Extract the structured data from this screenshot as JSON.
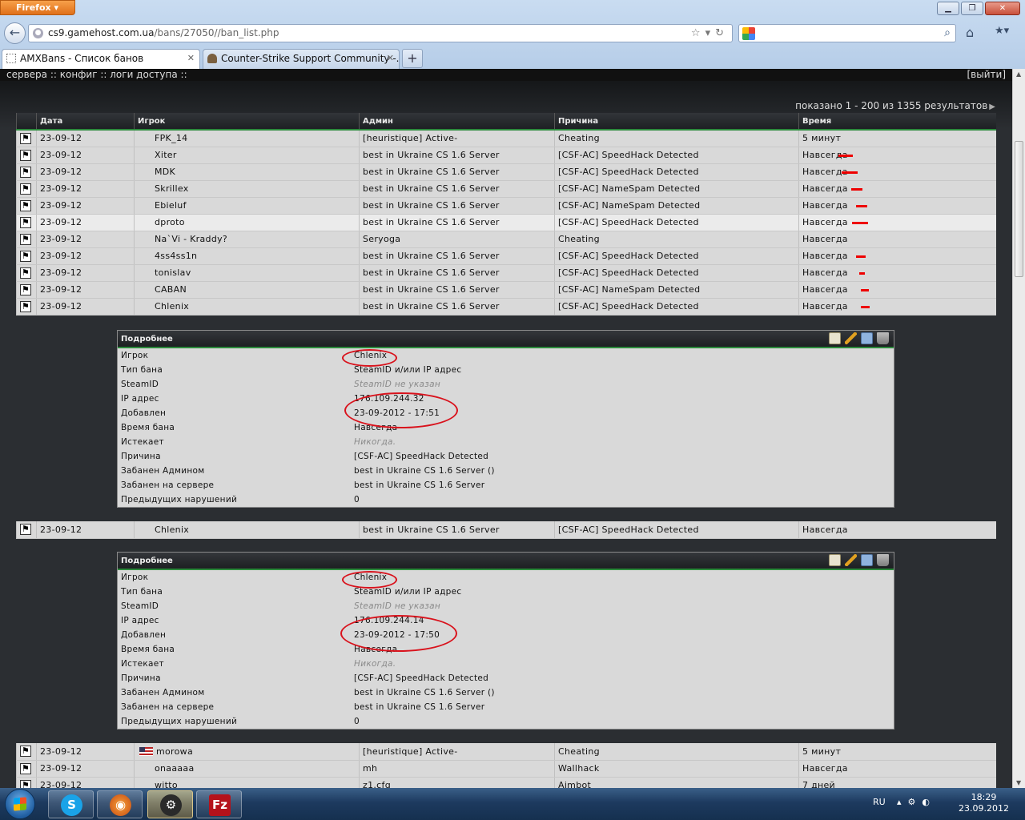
{
  "browser": {
    "menu_button": "Firefox",
    "url_domain": "cs9.gamehost.com.ua",
    "url_path": "/bans/27050//ban_list.php",
    "tabs": [
      {
        "title": "AMXBans - Список банов",
        "active": true
      },
      {
        "title": "Counter-Strike Support Community -...",
        "active": false
      }
    ],
    "new_tab": "+"
  },
  "page": {
    "nav": "сервера :: конфиг :: логи доступа ::",
    "logout": "[выйти]",
    "results": "показано 1 - 200 из 1355 результатов",
    "columns": {
      "date": "Дата",
      "player": "Игрок",
      "admin": "Админ",
      "reason": "Причина",
      "time": "Время"
    },
    "rows": [
      {
        "date": "23-09-12",
        "player": "FPK_14",
        "admin": "[heuristique] Active-",
        "reason": "Cheating",
        "time": "5 минут"
      },
      {
        "date": "23-09-12",
        "player": "Xiter",
        "admin": "best in Ukraine CS 1.6 Server",
        "reason": "[CSF-AC] SpeedHack Detected",
        "time": "Навсегда"
      },
      {
        "date": "23-09-12",
        "player": "MDK",
        "admin": "best in Ukraine CS 1.6 Server",
        "reason": "[CSF-AC] SpeedHack Detected",
        "time": "Навсегда"
      },
      {
        "date": "23-09-12",
        "player": "Skrillex",
        "admin": "best in Ukraine CS 1.6 Server",
        "reason": "[CSF-AC] NameSpam Detected",
        "time": "Навсегда"
      },
      {
        "date": "23-09-12",
        "player": "Ebieluf",
        "admin": "best in Ukraine CS 1.6 Server",
        "reason": "[CSF-AC] NameSpam Detected",
        "time": "Навсегда"
      },
      {
        "date": "23-09-12",
        "player": "dproto",
        "admin": "best in Ukraine CS 1.6 Server",
        "reason": "[CSF-AC] SpeedHack Detected",
        "time": "Навсегда"
      },
      {
        "date": "23-09-12",
        "player": "Na`Vi - Kraddy?",
        "admin": "Seryoga",
        "reason": "Cheating",
        "time": "Навсегда"
      },
      {
        "date": "23-09-12",
        "player": "4ss4ss1n",
        "admin": "best in Ukraine CS 1.6 Server",
        "reason": "[CSF-AC] SpeedHack Detected",
        "time": "Навсегда"
      },
      {
        "date": "23-09-12",
        "player": "tonislav",
        "admin": "best in Ukraine CS 1.6 Server",
        "reason": "[CSF-AC] SpeedHack Detected",
        "time": "Навсегда"
      },
      {
        "date": "23-09-12",
        "player": "CABAN",
        "admin": "best in Ukraine CS 1.6 Server",
        "reason": "[CSF-AC] NameSpam Detected",
        "time": "Навсегда"
      },
      {
        "date": "23-09-12",
        "player": "Chlenix",
        "admin": "best in Ukraine CS 1.6 Server",
        "reason": "[CSF-AC] SpeedHack Detected",
        "time": "Навсегда"
      },
      {
        "date": "23-09-12",
        "player": "Chlenix",
        "admin": "best in Ukraine CS 1.6 Server",
        "reason": "[CSF-AC] SpeedHack Detected",
        "time": "Навсегда"
      },
      {
        "date": "23-09-12",
        "player": "morowa",
        "admin": "[heuristique] Active-",
        "reason": "Cheating",
        "time": "5 минут"
      },
      {
        "date": "23-09-12",
        "player": "onaaaaa",
        "admin": "mh",
        "reason": "Wallhack",
        "time": "Навсегда"
      },
      {
        "date": "23-09-12",
        "player": "witto",
        "admin": "z1.cfg",
        "reason": "Aimbot",
        "time": "7 дней"
      }
    ],
    "detail_title": "Подробнее",
    "detail_labels": {
      "player": "Игрок",
      "ban_type": "Тип бана",
      "steamid": "SteamID",
      "ip": "IP адрес",
      "added": "Добавлен",
      "ban_time": "Время бана",
      "expires": "Истекает",
      "reason": "Причина",
      "banned_by_admin": "Забанен Админом",
      "banned_on_server": "Забанен на сервере",
      "prev_offences": "Предыдущих нарушений"
    },
    "details": [
      {
        "player": "Chlenix",
        "ban_type": "SteamID и/или IP адрес",
        "steamid": "SteamID не указан",
        "ip": "176.109.244.32",
        "added": "23-09-2012 - 17:51",
        "ban_time": "Навсегда",
        "expires": "Никогда.",
        "reason": "[CSF-AC] SpeedHack Detected",
        "banned_by_admin": "best in Ukraine CS 1.6 Server ()",
        "banned_on_server": "best in Ukraine CS 1.6 Server",
        "prev_offences": "0"
      },
      {
        "player": "Chlenix",
        "ban_type": "SteamID и/или IP адрес",
        "steamid": "SteamID не указан",
        "ip": "176.109.244.14",
        "added": "23-09-2012 - 17:50",
        "ban_time": "Навсегда",
        "expires": "Никогда.",
        "reason": "[CSF-AC] SpeedHack Detected",
        "banned_by_admin": "best in Ukraine CS 1.6 Server ()",
        "banned_on_server": "best in Ukraine CS 1.6 Server",
        "prev_offences": "0"
      }
    ]
  },
  "taskbar": {
    "lang": "RU",
    "time": "18:29",
    "date": "23.09.2012"
  }
}
